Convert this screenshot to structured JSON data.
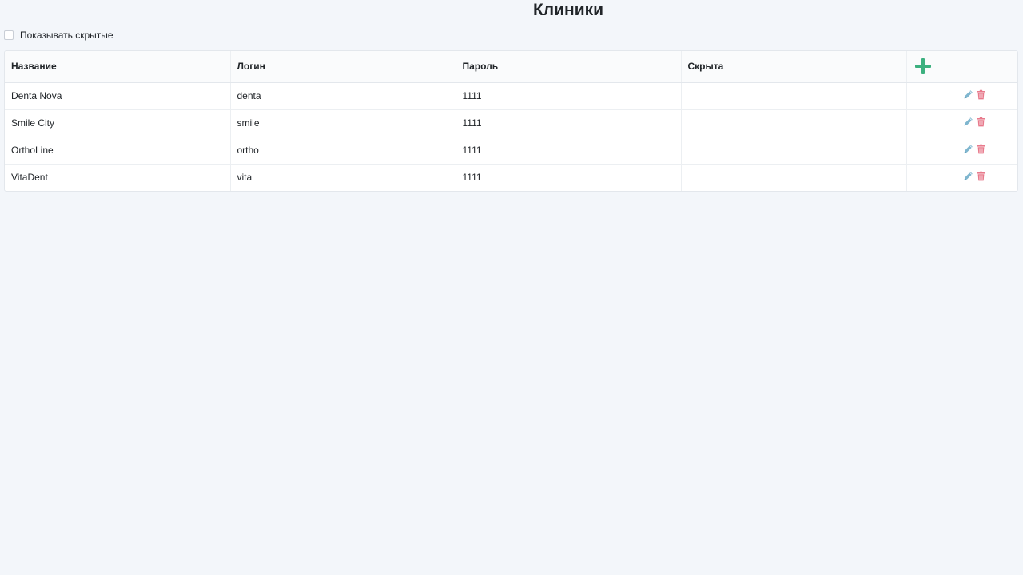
{
  "header": {
    "title": "Клиники"
  },
  "filter": {
    "show_hidden_label": "Показывать скрытые",
    "show_hidden_checked": false
  },
  "table": {
    "columns": [
      "Название",
      "Логин",
      "Пароль",
      "Скрыта"
    ],
    "rows": [
      {
        "name": "Denta Nova",
        "login": "denta",
        "password": "1111",
        "hidden": ""
      },
      {
        "name": "Smile City",
        "login": "smile",
        "password": "1111",
        "hidden": ""
      },
      {
        "name": "OrthoLine",
        "login": "ortho",
        "password": "1111",
        "hidden": ""
      },
      {
        "name": "VitaDent",
        "login": "vita",
        "password": "1111",
        "hidden": ""
      }
    ]
  },
  "icons": {
    "add": "plus-icon",
    "edit": "pencil-icon",
    "delete": "trash-icon"
  },
  "colors": {
    "background": "#f3f6fa",
    "add_green": "#3cb07f",
    "edit_blue": "#7fb6cf",
    "delete_red": "#e87a8c"
  }
}
